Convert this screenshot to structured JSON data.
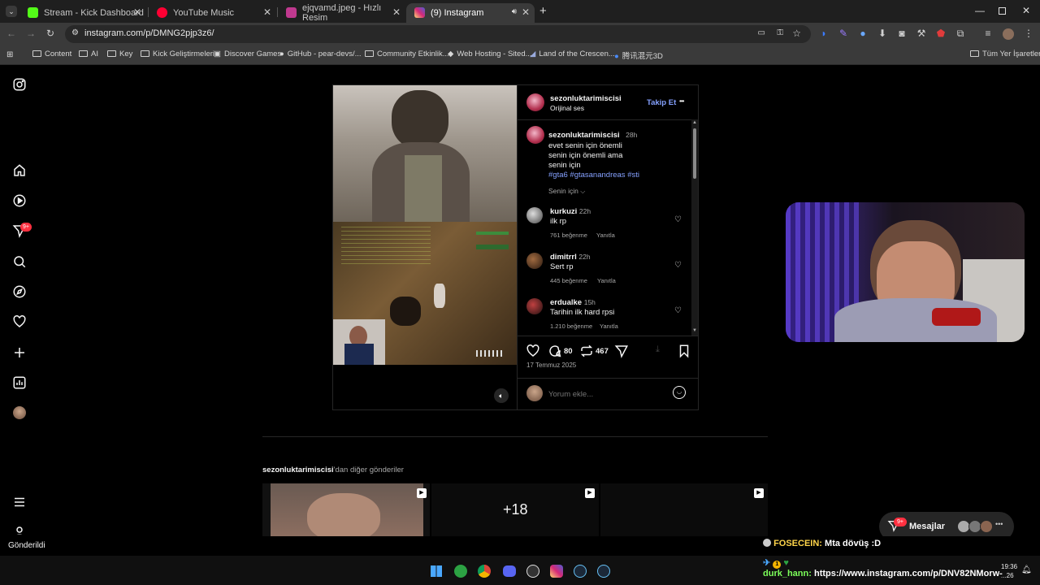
{
  "tabs": [
    {
      "title": "Stream - Kick Dashboard",
      "favicon_color": "#53fc18"
    },
    {
      "title": "YouTube Music",
      "favicon_color": "#ff0033"
    },
    {
      "title": "ejqvamd.jpeg - Hızlı Resim",
      "favicon_color": "#c0398f"
    },
    {
      "title": "(9) Instagram",
      "favicon_color": "#d62976"
    }
  ],
  "address": {
    "url": "instagram.com/p/DMNG2pjp3z6/"
  },
  "bookmarks": [
    "Content",
    "AI",
    "Key",
    "Kick Geliştirmeleri",
    "Discover Games",
    "GitHub - pear-devs/...",
    "Community Etkinlik...",
    "Web Hosting - Sited...",
    "Land of the Crescen...",
    "腾讯混元3D"
  ],
  "all_bookmarks": "Tüm Yer İşaretleri",
  "sidebar": {
    "notif_badge": "9+"
  },
  "post": {
    "author": "sezonluktarimiscisi",
    "audio": "Orijinal ses",
    "follow": "Takip Et",
    "more": "•••",
    "caption": {
      "author": "sezonluktarimiscisi",
      "time": "28h",
      "lines": [
        "evet senin için önemli",
        "senin için önemli ama",
        "senin için"
      ],
      "hashtags": "#gta6 #gtasanandreas #sti"
    },
    "sort": "Senin için",
    "comments": [
      {
        "user": "kurkuzi",
        "time": "22h",
        "text": "ilk rp",
        "likes": "761 beğenme",
        "reply": "Yanıtla"
      },
      {
        "user": "dimitrrl",
        "time": "22h",
        "text": "Sert rp",
        "likes": "445 beğenme",
        "reply": "Yanıtla"
      },
      {
        "user": "erdualke",
        "time": "15h",
        "text": "Tarihin ilk hard rpsi",
        "likes": "1.210 beğenme",
        "reply": "Yanıtla"
      }
    ],
    "comment_count": "80",
    "repost_count": "467",
    "date": "17 Temmuz 2025",
    "comment_placeholder": "Yorum ekle..."
  },
  "more_posts": {
    "author": "sezonluktarimiscisi",
    "suffix": "'dan diğer gönderiler",
    "overlay": "+18"
  },
  "messages": {
    "label": "Mesajlar",
    "badge": "9+"
  },
  "status": {
    "text": "Gönderildi"
  },
  "chat": [
    {
      "user": "FOSECEIN:",
      "text": "Mta dövüş :D",
      "user_color": "#ffd54a"
    },
    {
      "user": "durk_hann:",
      "text": "https://www.instagram.com/p/DNV82NMorw-",
      "user_color": "#7cff5a"
    }
  ],
  "clock": {
    "time": "19:36",
    "date": "...26"
  }
}
